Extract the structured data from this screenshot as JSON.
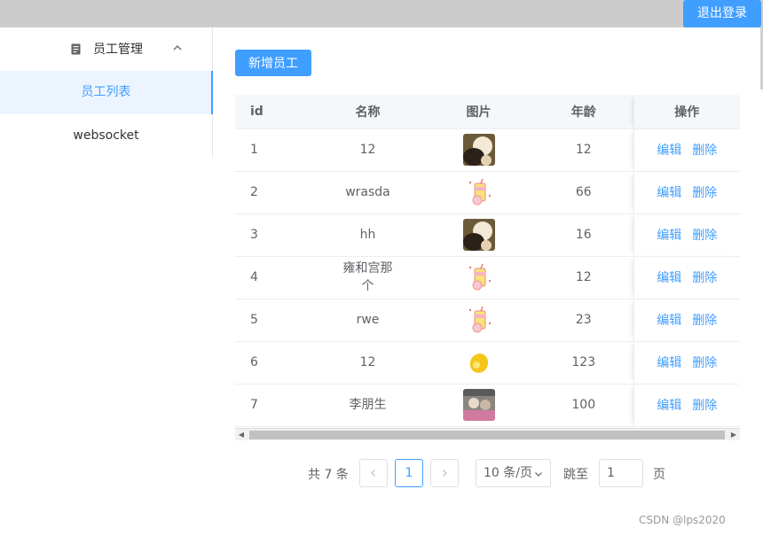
{
  "header": {
    "logout_label": "退出登录"
  },
  "sidebar": {
    "group_title": "员工管理",
    "items": [
      {
        "label": "员工列表",
        "active": true
      },
      {
        "label": "websocket",
        "active": false
      }
    ]
  },
  "toolbar": {
    "add_label": "新增员工"
  },
  "table": {
    "columns": [
      "id",
      "名称",
      "图片",
      "年龄",
      "操作"
    ],
    "rows": [
      {
        "id": "1",
        "name": "12",
        "image": "portrait-photo",
        "age": "12"
      },
      {
        "id": "2",
        "name": "wrasda",
        "image": "drink-cup-icon",
        "age": "66"
      },
      {
        "id": "3",
        "name": "hh",
        "image": "portrait-photo",
        "age": "16"
      },
      {
        "id": "4",
        "name": "雍和宫那个",
        "image": "drink-cup-icon",
        "age": "12"
      },
      {
        "id": "5",
        "name": "rwe",
        "image": "drink-cup-icon",
        "age": "23"
      },
      {
        "id": "6",
        "name": "12",
        "image": "lemon-icon",
        "age": "123"
      },
      {
        "id": "7",
        "name": "李朋生",
        "image": "group-photo",
        "age": "100"
      }
    ],
    "actions": {
      "edit": "编辑",
      "delete": "删除"
    }
  },
  "pagination": {
    "total_text": "共 7 条",
    "current_page": "1",
    "page_size_label": "10 条/页",
    "jump_label": "跳至",
    "jump_value": "1",
    "page_suffix": "页"
  },
  "watermark": "CSDN @lps2020",
  "colors": {
    "primary": "#409eff",
    "topbar": "#cccccc",
    "active_bg": "#ecf5ff"
  }
}
